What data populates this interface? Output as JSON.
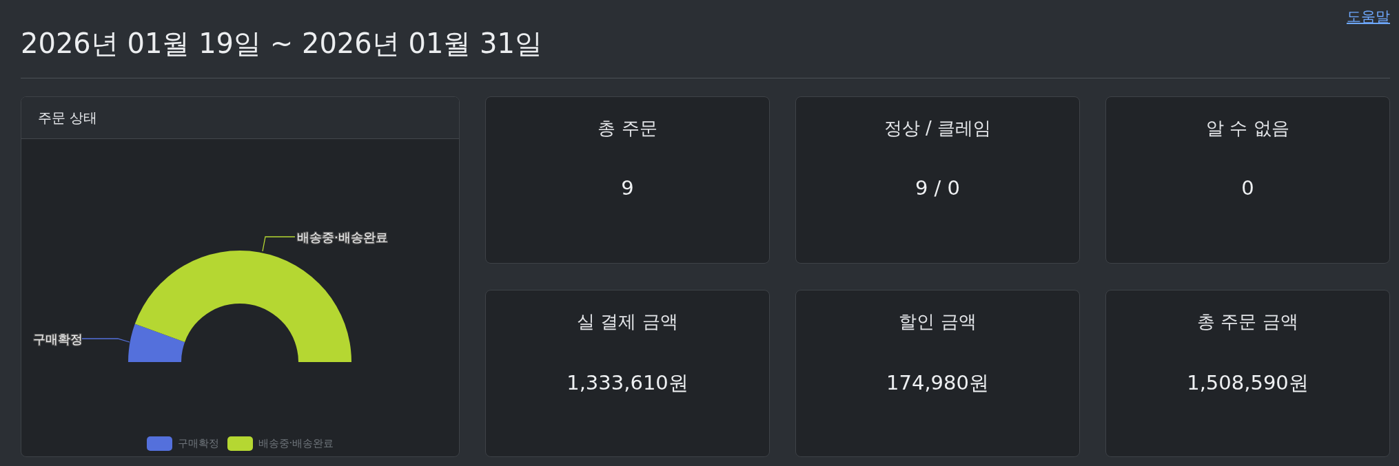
{
  "help_link": "도움말",
  "title": "2026년 01월 19일 ~ 2026년 01월 31일",
  "order_status": {
    "title": "주문 상태",
    "series": [
      {
        "label": "구매확정",
        "legend": "구매확정",
        "color": "#5470dc"
      },
      {
        "label": "배송중·배송완료",
        "legend": "배송중·배송완료",
        "color": "#b5d732"
      }
    ]
  },
  "stats": [
    {
      "label": "총 주문",
      "value": "9"
    },
    {
      "label": "정상 / 클레임",
      "value": "9 / 0"
    },
    {
      "label": "알 수 없음",
      "value": "0"
    },
    {
      "label": "실 결제 금액",
      "value": "1,333,610원"
    },
    {
      "label": "할인 금액",
      "value": "174,980원"
    },
    {
      "label": "총 주문 금액",
      "value": "1,508,590원"
    }
  ]
}
